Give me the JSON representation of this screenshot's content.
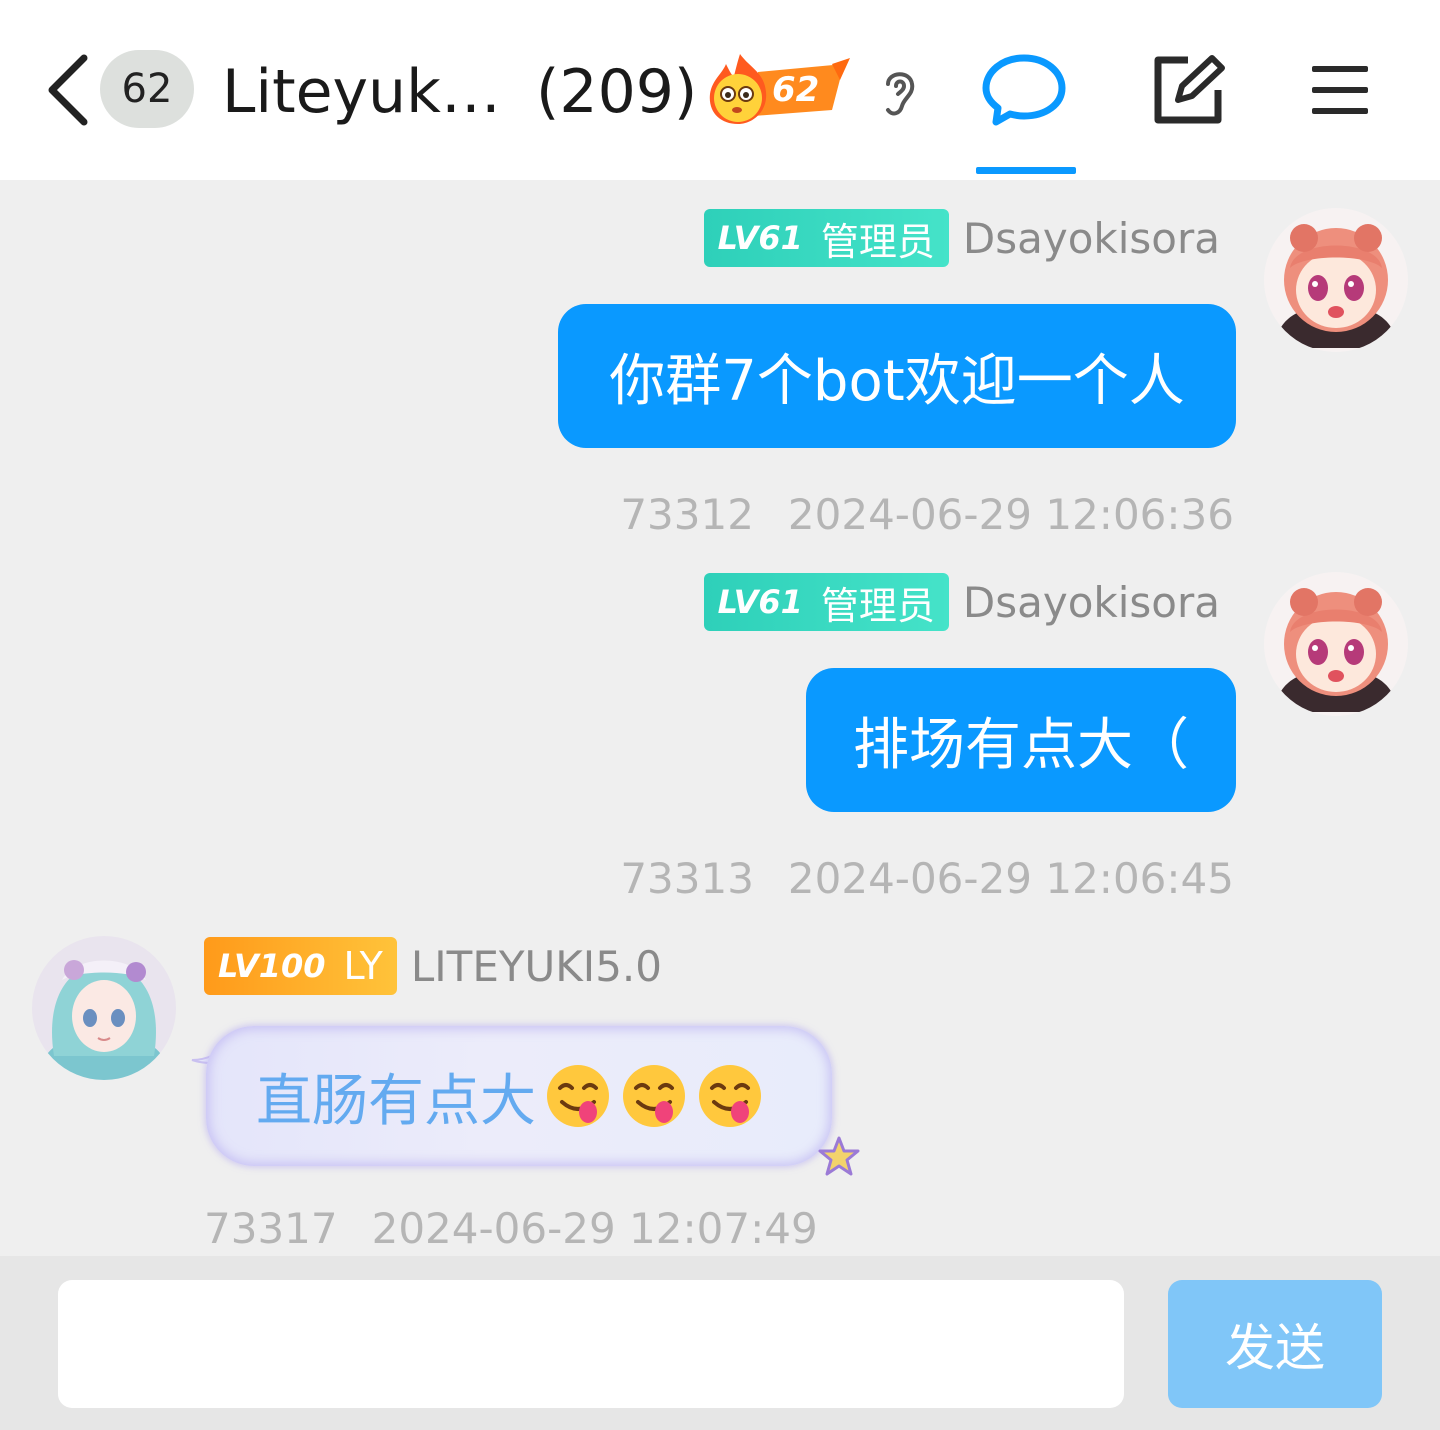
{
  "header": {
    "unread_count": "62",
    "group_title": "Liteyuki...",
    "member_count": "(209)",
    "fire_level": "62",
    "accent_color": "#0a99ff"
  },
  "messages": [
    {
      "side": "right",
      "level": "LV61",
      "role": "管理员",
      "nick": "Dsayokisora",
      "text": "你群7个bot欢迎一个人",
      "msg_id": "73312",
      "time": "2024-06-29 12:06:36"
    },
    {
      "side": "right",
      "level": "LV61",
      "role": "管理员",
      "nick": "Dsayokisora",
      "text": "排场有点大（",
      "msg_id": "73313",
      "time": "2024-06-29 12:06:45"
    },
    {
      "side": "left",
      "level": "LV100",
      "role": "LY",
      "nick": "LITEYUKI5.0",
      "text": "直肠有点大",
      "emojis": [
        "yum-emoji",
        "yum-emoji",
        "yum-emoji"
      ],
      "msg_id": "73317",
      "time": "2024-06-29 12:07:49"
    }
  ],
  "input": {
    "value": "",
    "send_label": "发送"
  }
}
